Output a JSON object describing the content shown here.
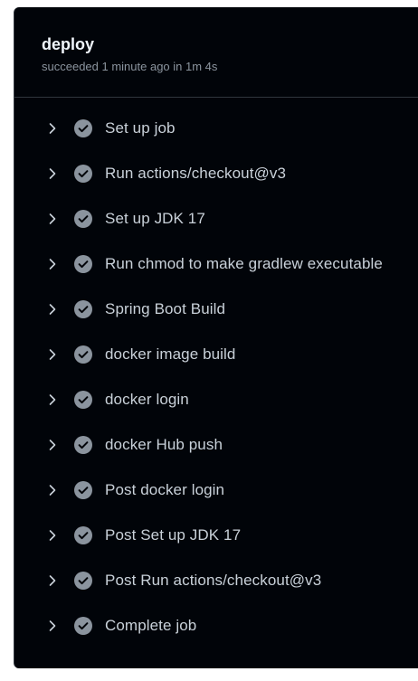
{
  "job": {
    "title": "deploy",
    "status": "succeeded 1 minute ago in 1m 4s"
  },
  "steps": [
    {
      "label": "Set up job",
      "state": "success"
    },
    {
      "label": "Run actions/checkout@v3",
      "state": "success"
    },
    {
      "label": "Set up JDK 17",
      "state": "success"
    },
    {
      "label": "Run chmod to make gradlew executable",
      "state": "success"
    },
    {
      "label": "Spring Boot Build",
      "state": "success"
    },
    {
      "label": "docker image build",
      "state": "success"
    },
    {
      "label": "docker login",
      "state": "success"
    },
    {
      "label": "docker Hub push",
      "state": "success"
    },
    {
      "label": "Post docker login",
      "state": "success"
    },
    {
      "label": "Post Set up JDK 17",
      "state": "success"
    },
    {
      "label": "Post Run actions/checkout@v3",
      "state": "success"
    },
    {
      "label": "Complete job",
      "state": "success"
    }
  ],
  "icons": {
    "expand": "chevron-right-icon",
    "status": "check-circle-fill-icon"
  },
  "colors": {
    "background": "#010409",
    "border": "#30363d",
    "title": "#f0f6fc",
    "text": "#c9d1d9",
    "muted": "#8b949e",
    "check_fill": "#8b949e"
  }
}
